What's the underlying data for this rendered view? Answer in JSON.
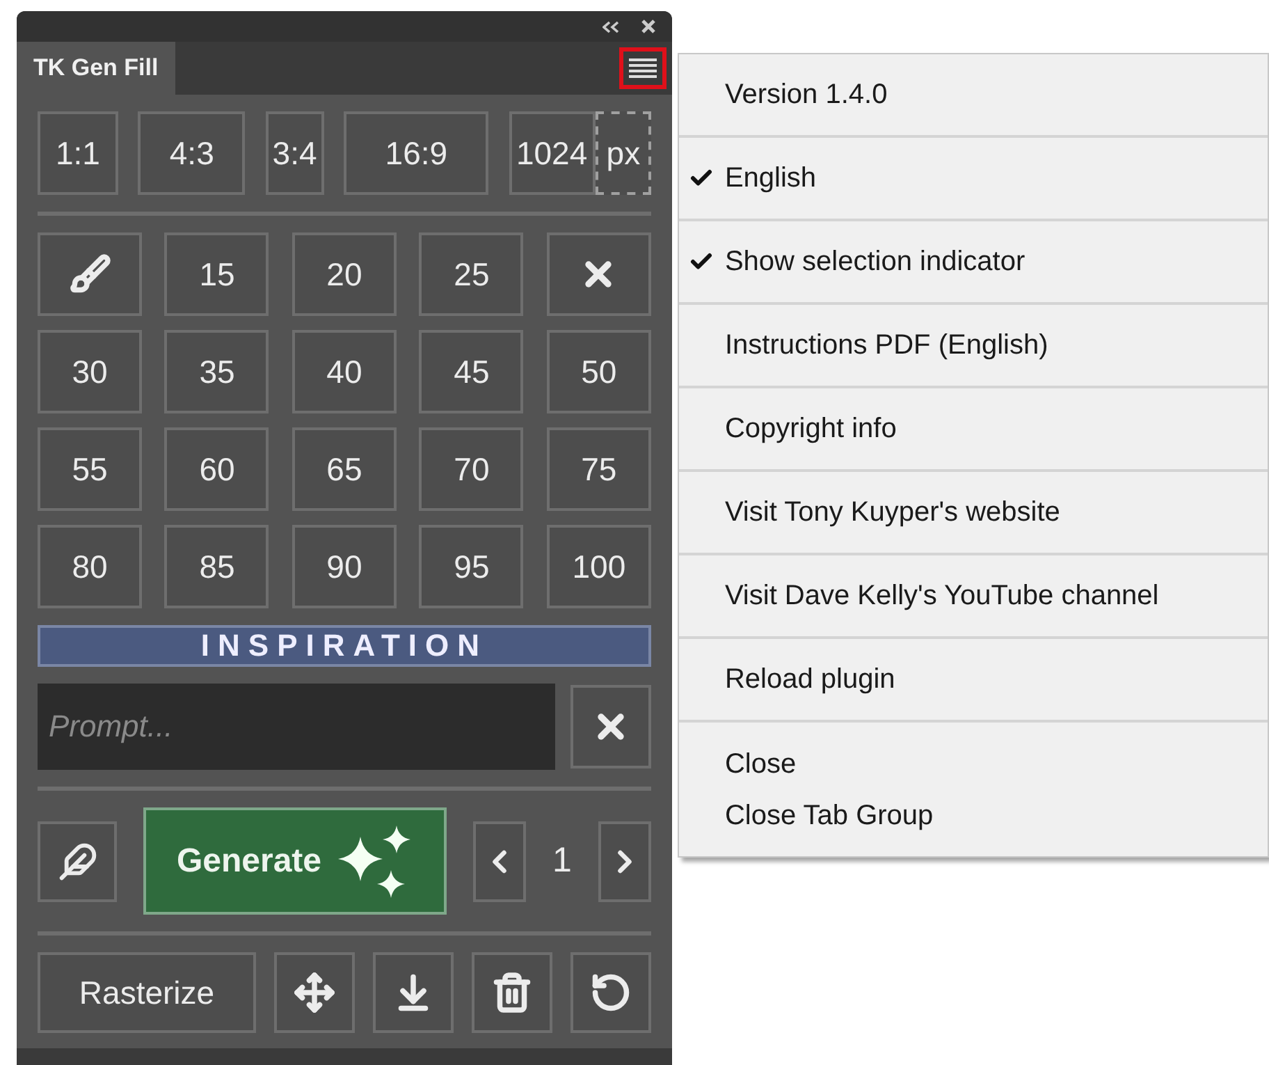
{
  "panel": {
    "tab": "TK Gen Fill",
    "ratios": [
      "1:1",
      "4:3",
      "3:4",
      "16:9",
      "1024"
    ],
    "unit": {
      "label": "px",
      "selected": false
    },
    "sizes": [
      "15",
      "20",
      "25",
      "30",
      "35",
      "40",
      "45",
      "50",
      "55",
      "60",
      "65",
      "70",
      "75",
      "80",
      "85",
      "90",
      "95",
      "100"
    ],
    "section_title": "INSPIRATION",
    "prompt": {
      "placeholder": "Prompt..."
    },
    "generate": "Generate",
    "page": "1",
    "rasterize": "Rasterize"
  },
  "menu": {
    "sections": [
      [
        {
          "label": "Version 1.4.0",
          "checked": false
        }
      ],
      [
        {
          "label": "English",
          "checked": true
        }
      ],
      [
        {
          "label": "Show selection indicator",
          "checked": true
        }
      ],
      [
        {
          "label": "Instructions PDF (English)",
          "checked": false
        }
      ],
      [
        {
          "label": "Copyright info",
          "checked": false
        }
      ],
      [
        {
          "label": "Visit Tony Kuyper's website",
          "checked": false
        }
      ],
      [
        {
          "label": "Visit Dave Kelly's YouTube channel",
          "checked": false
        }
      ],
      [
        {
          "label": "Reload plugin",
          "checked": false
        }
      ],
      [
        {
          "label": "Close",
          "checked": false
        },
        {
          "label": "Close Tab Group",
          "checked": false
        }
      ]
    ]
  }
}
